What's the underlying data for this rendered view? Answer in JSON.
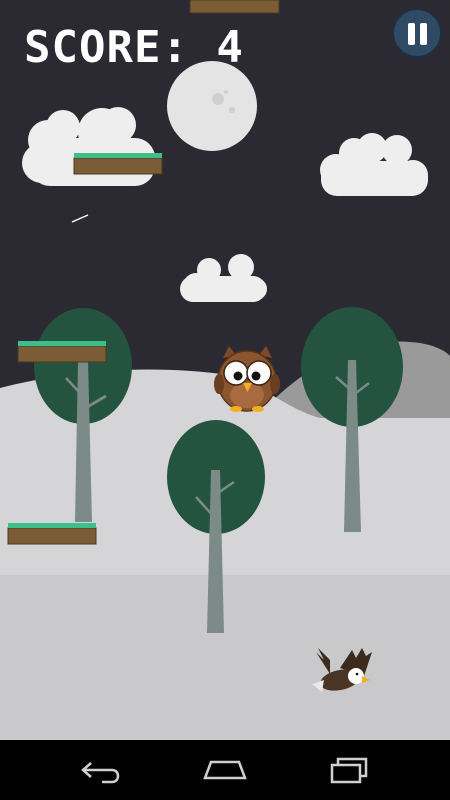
{
  "hud": {
    "score_text": "SCORE: 4",
    "pause_icon": "pause-icon"
  },
  "scene": {
    "sky_color": "#2b2a33",
    "snow_color": "#d5d5d7",
    "far_hill_color": "#9a9a9a",
    "tree_crown_color": "#245440",
    "tree_trunk_color": "#7c8a88",
    "cloud_color": "#eeeeee",
    "moon_color": "#e4e4e4",
    "platform_grass_color": "#3dbf8a",
    "platform_dirt_color": "#7c5c37"
  },
  "player": {
    "name": "owl",
    "icon": "owl-icon"
  },
  "enemy": {
    "name": "eagle",
    "icon": "eagle-icon"
  },
  "navigation_bar": {
    "buttons": [
      {
        "name": "back",
        "icon": "back-arrow-icon"
      },
      {
        "name": "home",
        "icon": "home-icon"
      },
      {
        "name": "recents",
        "icon": "recent-apps-icon"
      }
    ]
  }
}
